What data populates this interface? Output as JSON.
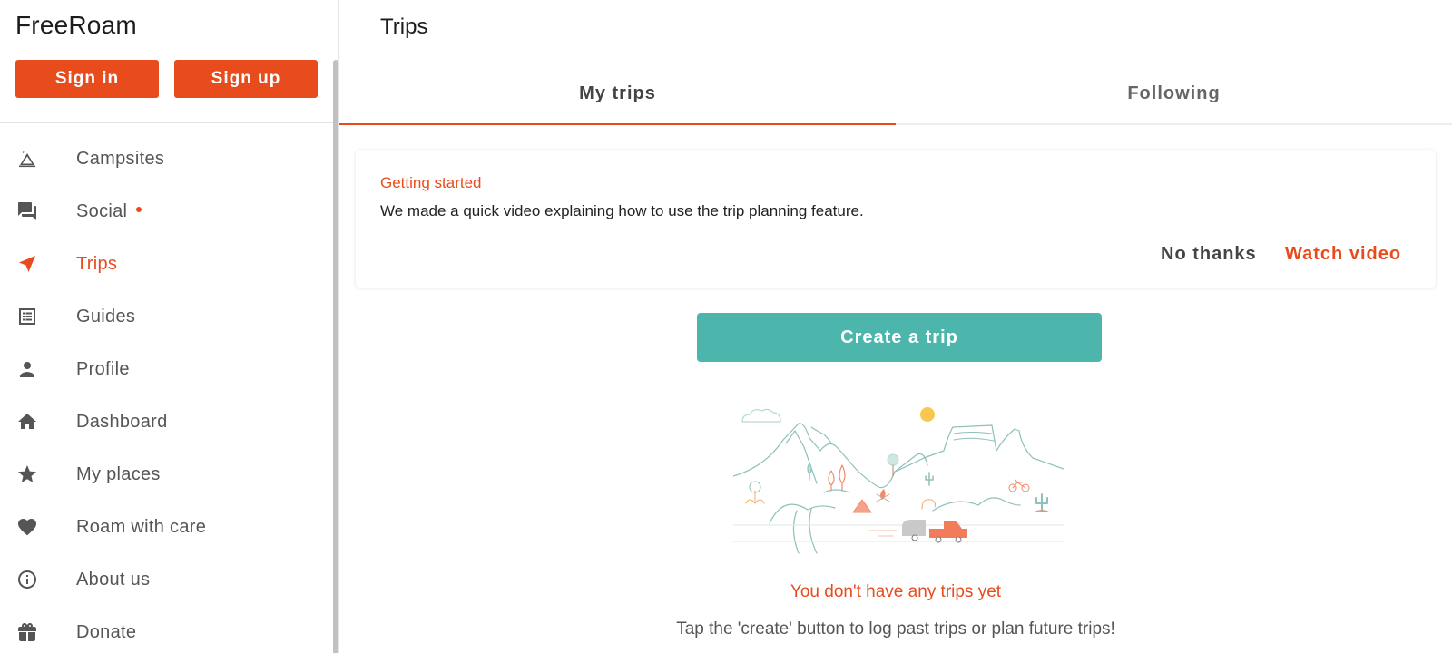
{
  "app": {
    "brand": "FreeRoam",
    "accent_color": "#e84c1d",
    "teal_color": "#4db6ac"
  },
  "auth": {
    "sign_in_label": "Sign in",
    "sign_up_label": "Sign up"
  },
  "sidebar": {
    "items": [
      {
        "label": "Campsites",
        "icon": "tent-icon",
        "active": false
      },
      {
        "label": "Social",
        "icon": "chat-icon",
        "active": false,
        "badge": true
      },
      {
        "label": "Trips",
        "icon": "navigation-arrow-icon",
        "active": true
      },
      {
        "label": "Guides",
        "icon": "list-icon",
        "active": false
      },
      {
        "label": "Profile",
        "icon": "person-icon",
        "active": false
      },
      {
        "label": "Dashboard",
        "icon": "home-icon",
        "active": false
      },
      {
        "label": "My places",
        "icon": "star-icon",
        "active": false
      },
      {
        "label": "Roam with care",
        "icon": "heart-icon",
        "active": false
      },
      {
        "label": "About us",
        "icon": "info-icon",
        "active": false
      },
      {
        "label": "Donate",
        "icon": "gift-icon",
        "active": false
      }
    ]
  },
  "main": {
    "title": "Trips",
    "tabs": [
      {
        "label": "My trips",
        "active": true
      },
      {
        "label": "Following",
        "active": false
      }
    ],
    "getting_started": {
      "title": "Getting started",
      "text": "We made a quick video explaining how to use the trip planning feature.",
      "dismiss_label": "No thanks",
      "action_label": "Watch video"
    },
    "create_label": "Create a trip",
    "empty_state": {
      "title": "You don't have any trips yet",
      "text": "Tap the 'create' button to log past trips or plan future trips!"
    }
  }
}
